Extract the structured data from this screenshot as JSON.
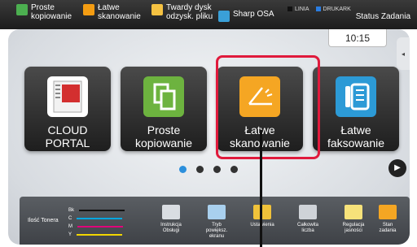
{
  "topbar": {
    "items": [
      {
        "label": "Proste\nkopiowanie",
        "icon": "copy-icon",
        "color": "#4caf50"
      },
      {
        "label": "Łatwe\nskanowanie",
        "icon": "scan-icon",
        "color": "#f39c12"
      },
      {
        "label": "Twardy dysk\nodzysk. pliku",
        "icon": "folder-icon",
        "color": "#f5c242"
      },
      {
        "label": "Sharp OSA",
        "icon": "osa-icon",
        "color": "#3aa0d8"
      }
    ],
    "status_indicators": [
      {
        "label": "LINIA",
        "color": "#111111"
      },
      {
        "label": "DRUKARK",
        "color": "#2a7de1"
      }
    ],
    "status_button": "Status Zadania"
  },
  "clock": "10:15",
  "tiles": [
    {
      "label": "CLOUD PORTAL",
      "icon": "cloud-portal-icon",
      "icon_color": "#ffffff",
      "icon_text": "CLOUD PORTAL"
    },
    {
      "label": "Proste kopiowanie",
      "icon": "copy-icon",
      "icon_color": "#6db33f"
    },
    {
      "label": "Łatwe skanowanie",
      "icon": "scan-icon",
      "icon_color": "#f5a623"
    },
    {
      "label": "Łatwe faksowanie",
      "icon": "fax-icon",
      "icon_color": "#2c9ad6"
    }
  ],
  "page_dots": {
    "count": 4,
    "active": 0
  },
  "bottombar": {
    "toner_label": "Ilość Tonera",
    "toners": [
      {
        "name": "Bk",
        "color": "#111111"
      },
      {
        "name": "C",
        "color": "#00a6e0"
      },
      {
        "name": "M",
        "color": "#e0007a"
      },
      {
        "name": "Y",
        "color": "#f2d600"
      }
    ],
    "items": [
      {
        "label": "Instrukcja\nObsługi",
        "icon": "manual-icon"
      },
      {
        "label": "Tryb\npowiększ.\nekranu",
        "icon": "zoom-text-icon"
      },
      {
        "label": "Ustawienia",
        "icon": "wrench-icon"
      },
      {
        "label": "Całkowita\nliczba",
        "icon": "counter-icon"
      },
      {
        "label": "Regulacja\njasności",
        "icon": "brightness-icon"
      },
      {
        "label": "Stan\nzadania",
        "icon": "job-status-icon"
      }
    ]
  }
}
